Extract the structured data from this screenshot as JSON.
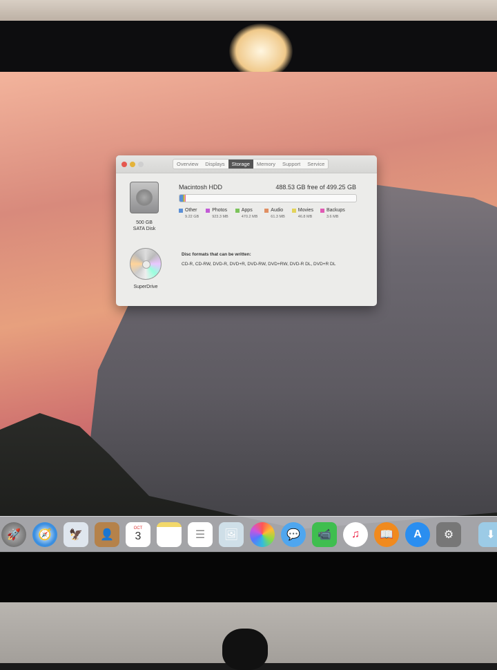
{
  "window": {
    "tabs": [
      {
        "label": "Overview"
      },
      {
        "label": "Displays"
      },
      {
        "label": "Storage",
        "active": true
      },
      {
        "label": "Memory"
      },
      {
        "label": "Support"
      },
      {
        "label": "Service"
      }
    ],
    "disk": {
      "size": "500 GB",
      "type": "SATA Disk",
      "name": "Macintosh HDD",
      "free": "488.53 GB free of 499.25 GB"
    },
    "usage_total_gb": 499.25,
    "categories": [
      {
        "label": "Other",
        "value": "9.22 GB",
        "color": "#5b8fd6"
      },
      {
        "label": "Photos",
        "value": "923.3 MB",
        "color": "#c25ad6"
      },
      {
        "label": "Apps",
        "value": "470.2 MB",
        "color": "#7cc35b"
      },
      {
        "label": "Audio",
        "value": "61.3 MB",
        "color": "#e08f63"
      },
      {
        "label": "Movies",
        "value": "46.8 MB",
        "color": "#e3d35a"
      },
      {
        "label": "Backups",
        "value": "3.6 MB",
        "color": "#e05ab4"
      }
    ],
    "drive": {
      "name": "SuperDrive",
      "heading": "Disc formats that can be written:",
      "formats": "CD-R, CD-RW, DVD-R, DVD+R, DVD-RW, DVD+RW, DVD-R DL, DVD+R DL"
    }
  },
  "dock": {
    "calendar_month": "OCT",
    "calendar_day": "3",
    "apps": [
      "launchpad",
      "safari",
      "mail",
      "contacts",
      "calendar",
      "notes",
      "reminders",
      "preview",
      "photos",
      "messages",
      "facetime",
      "itunes",
      "ibooks",
      "app-store",
      "system-preferences",
      "downloads"
    ]
  }
}
